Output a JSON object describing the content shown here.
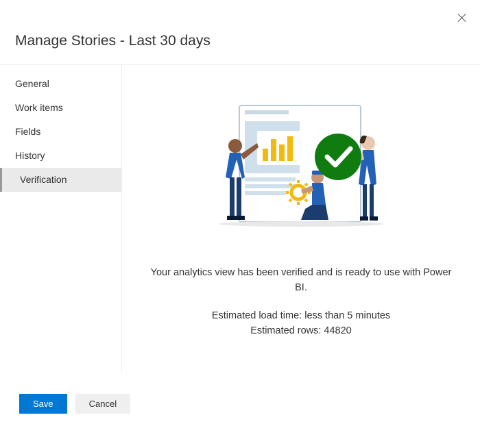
{
  "dialog": {
    "title": "Manage Stories - Last 30 days"
  },
  "sidebar": {
    "items": [
      {
        "label": "General",
        "active": false
      },
      {
        "label": "Work items",
        "active": false
      },
      {
        "label": "Fields",
        "active": false
      },
      {
        "label": "History",
        "active": false
      },
      {
        "label": "Verification",
        "active": true
      }
    ]
  },
  "verification": {
    "message": "Your analytics view has been verified and is ready to use with Power BI.",
    "load_time_label": "Estimated load time: ",
    "load_time_value": "less than 5 minutes",
    "rows_label": "Estimated rows: ",
    "rows_value": "44820"
  },
  "footer": {
    "save_label": "Save",
    "cancel_label": "Cancel"
  }
}
